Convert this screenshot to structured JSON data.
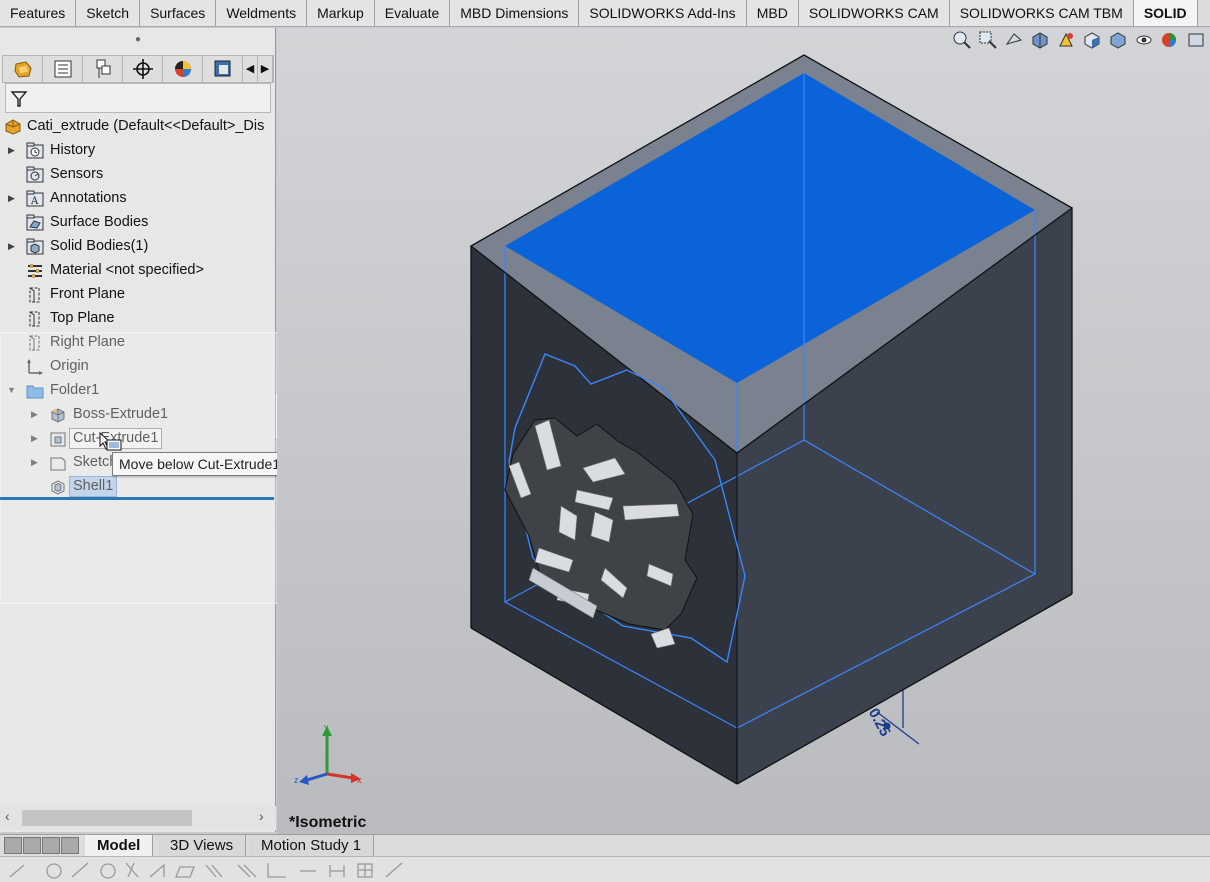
{
  "command_tabs": [
    "Features",
    "Sketch",
    "Surfaces",
    "Weldments",
    "Markup",
    "Evaluate",
    "MBD Dimensions",
    "SOLIDWORKS Add-Ins",
    "MBD",
    "SOLIDWORKS CAM",
    "SOLIDWORKS CAM TBM",
    "SOLID"
  ],
  "feature_tree": {
    "part_name": "Cati_extrude  (Default<<Default>_Dis",
    "items": [
      {
        "label": "History",
        "icon": "history-icon"
      },
      {
        "label": "Sensors",
        "icon": "sensors-icon"
      },
      {
        "label": "Annotations",
        "icon": "annotations-icon"
      },
      {
        "label": "Surface Bodies",
        "icon": "surface-bodies-icon"
      },
      {
        "label": "Solid Bodies(1)",
        "icon": "solid-bodies-icon"
      },
      {
        "label": "Material <not specified>",
        "icon": "material-icon"
      },
      {
        "label": "Front Plane",
        "icon": "plane-icon"
      },
      {
        "label": "Top Plane",
        "icon": "plane-icon"
      },
      {
        "label": "Right Plane",
        "icon": "plane-icon"
      },
      {
        "label": "Origin",
        "icon": "origin-icon"
      },
      {
        "label": "Folder1",
        "icon": "folder-icon"
      },
      {
        "label": "Boss-Extrude1",
        "icon": "boss-extrude-icon"
      },
      {
        "label": "Cut-Extrude1",
        "icon": "cut-extrude-icon"
      },
      {
        "label": "Sketch",
        "icon": "sketch-icon"
      },
      {
        "label": "Shell1",
        "icon": "shell-icon"
      }
    ]
  },
  "tooltip": "Move below Cut-Extrude1",
  "viewport": {
    "view_name": "*Isometric",
    "dimension_value": "0.25",
    "triad": {
      "x": "x",
      "y": "y",
      "z": "z"
    }
  },
  "bottom_tabs": [
    "Model",
    "3D Views",
    "Motion Study 1"
  ],
  "colors": {
    "selected_face": "#0a63d9",
    "edge_highlight": "#3a86ff",
    "drop_line": "#2a78b5"
  }
}
